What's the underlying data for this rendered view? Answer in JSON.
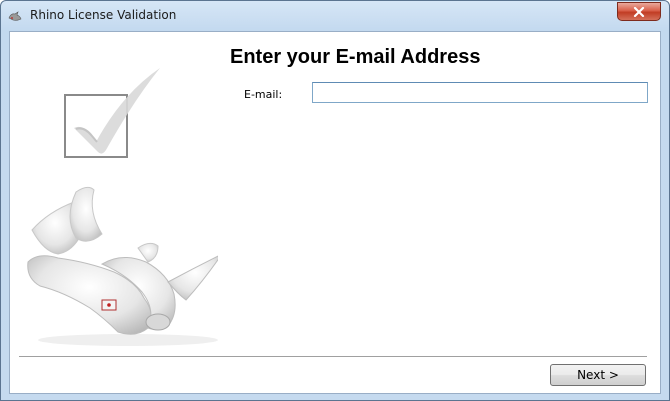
{
  "window": {
    "title": "Rhino License Validation",
    "close_icon": "close-icon",
    "app_icon": "rhino-app-icon"
  },
  "main": {
    "heading": "Enter your E-mail Address",
    "email": {
      "label": "E-mail:",
      "value": "",
      "placeholder": ""
    }
  },
  "footer": {
    "next_label": "Next >"
  },
  "colors": {
    "titlebar": "#c5daef",
    "close_button": "#c13d24",
    "input_border": "#7fa7c8"
  }
}
